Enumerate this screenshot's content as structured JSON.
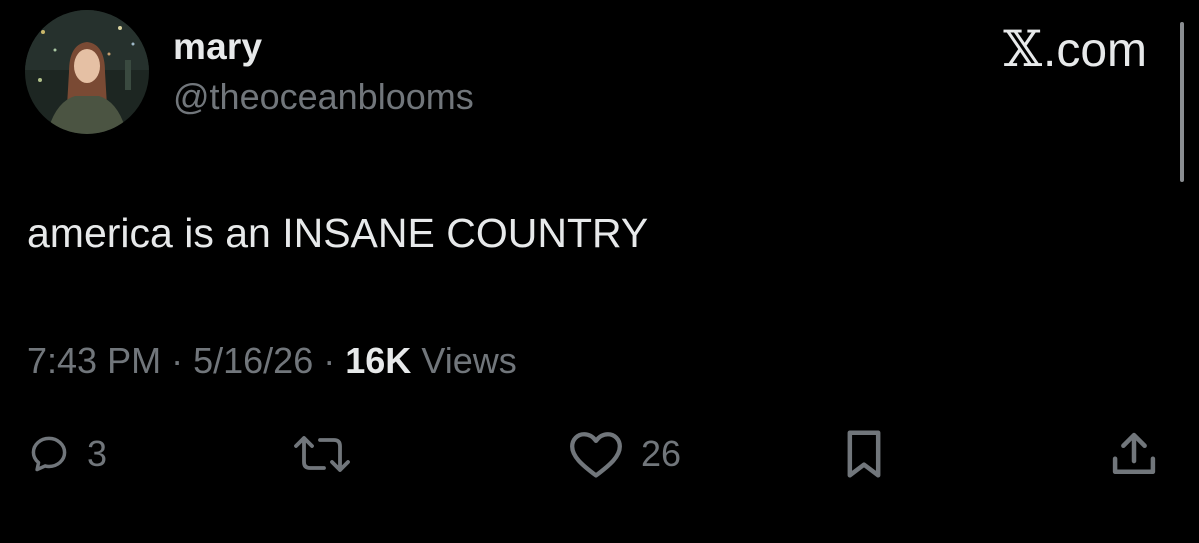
{
  "author": {
    "display_name": "mary",
    "handle": "@theoceanblooms",
    "avatar_icon": "profile-photo"
  },
  "brand": {
    "x_mark": "𝕏",
    "domain": ".com"
  },
  "tweet": {
    "text": "america is an INSANE COUNTRY"
  },
  "meta": {
    "time": "7:43 PM",
    "separator": "·",
    "date": "5/16/26",
    "views_count": "16K",
    "views_label": "Views"
  },
  "actions": {
    "reply": {
      "icon": "reply-icon",
      "count": "3"
    },
    "retweet": {
      "icon": "retweet-icon"
    },
    "like": {
      "icon": "heart-icon",
      "count": "26"
    },
    "bookmark": {
      "icon": "bookmark-icon"
    },
    "share": {
      "icon": "share-icon"
    }
  },
  "colors": {
    "background": "#000000",
    "primary_text": "#e7e9ea",
    "secondary_text": "#71767b"
  }
}
